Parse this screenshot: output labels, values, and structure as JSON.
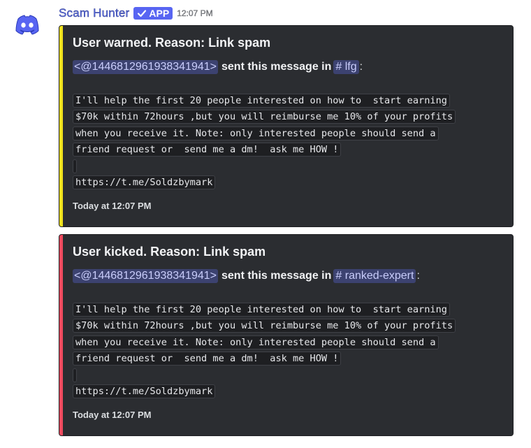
{
  "message": {
    "author": "Scam Hunter",
    "badge": "APP",
    "timestamp": "12:07 PM",
    "avatar_icon": "discord-logo-icon"
  },
  "colors": {
    "warn_bar": "#f0e11d",
    "kick_bar": "#ef4a5e",
    "accent": "#5865f2"
  },
  "embeds": [
    {
      "title": "User warned. Reason: Link spam",
      "mention": "<@1446812961938341941>",
      "sent_text": "sent this message in",
      "channel": "# lfg",
      "colon": ":",
      "code_lines": [
        "I'll help the first 20 people interested on how to  start earning",
        "$70k within 72hours ,but you will reimburse me 10% of your profits",
        "when you receive it. Note: only interested people should send a",
        "friend request or  send me a dm!  ask me HOW !",
        "",
        "https://t.me/Soldzbymark"
      ],
      "footer": "Today at 12:07 PM"
    },
    {
      "title": "User kicked. Reason: Link spam",
      "mention": "<@1446812961938341941>",
      "sent_text": "sent this message in",
      "channel": "# ranked-expert",
      "colon": ":",
      "code_lines": [
        "I'll help the first 20 people interested on how to  start earning",
        "$70k within 72hours ,but you will reimburse me 10% of your profits",
        "when you receive it. Note: only interested people should send a",
        "friend request or  send me a dm!  ask me HOW !",
        "",
        "https://t.me/Soldzbymark"
      ],
      "footer": "Today at 12:07 PM"
    }
  ]
}
